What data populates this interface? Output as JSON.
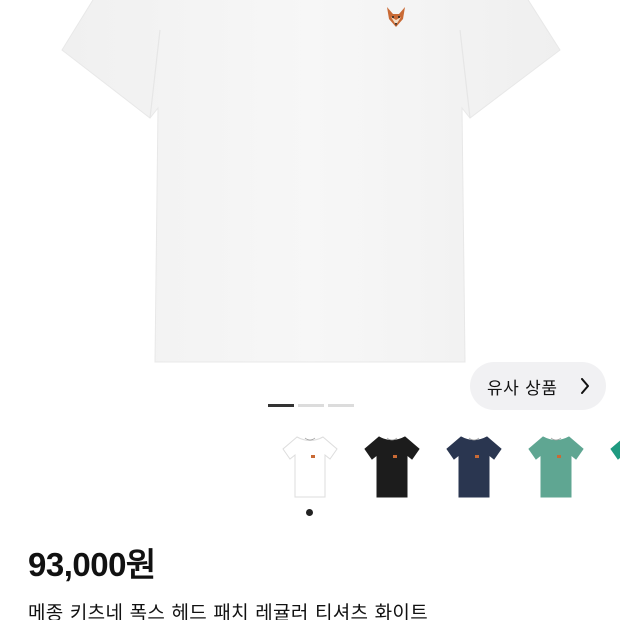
{
  "similar_button": {
    "label": "유사 상품",
    "icon": "chevron-right-icon"
  },
  "image_pager": {
    "count": 3,
    "active": 0
  },
  "color_swatches": [
    {
      "color": "#ffffff",
      "selected": true
    },
    {
      "color": "#1c1c1c",
      "selected": false
    },
    {
      "color": "#2a3650",
      "selected": false
    },
    {
      "color": "#5fa692",
      "selected": false
    },
    {
      "color": "#1f9a80",
      "selected": false
    }
  ],
  "product": {
    "price": "93,000원",
    "title": "메종 키츠네 폭스 헤드 패치 레귤러 티셔츠 화이트"
  },
  "hero_image": {
    "subject": "white-tshirt",
    "patch_icon": "fox-head-icon"
  }
}
